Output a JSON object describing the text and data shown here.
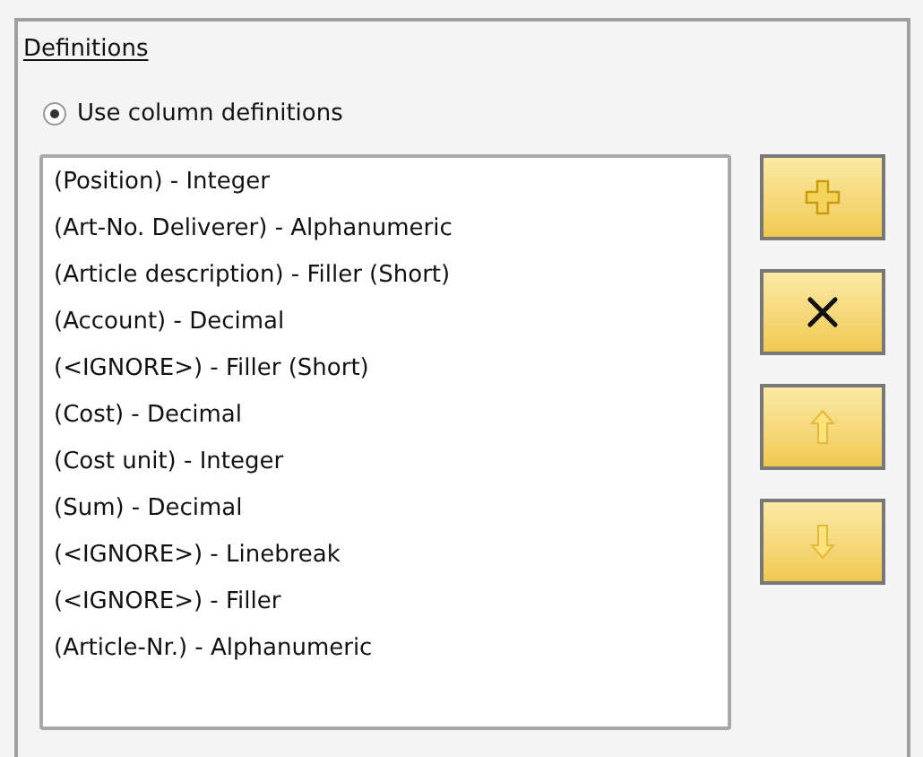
{
  "group": {
    "title": "Definitions"
  },
  "radio": {
    "label": "Use column definitions",
    "selected": true
  },
  "list": {
    "items": [
      "(Position) - Integer",
      "(Art-No. Deliverer) - Alphanumeric",
      "(Article description) - Filler (Short)",
      "(Account) - Decimal",
      "(<IGNORE>) - Filler (Short)",
      "(Cost) - Decimal",
      "(Cost unit) - Integer",
      "(Sum) - Decimal",
      "(<IGNORE>) - Linebreak",
      "(<IGNORE>) - Filler",
      "(Article-Nr.) - Alphanumeric"
    ]
  },
  "buttons": [
    {
      "kind": "add"
    },
    {
      "kind": "delete"
    },
    {
      "kind": "up"
    },
    {
      "kind": "down"
    }
  ]
}
